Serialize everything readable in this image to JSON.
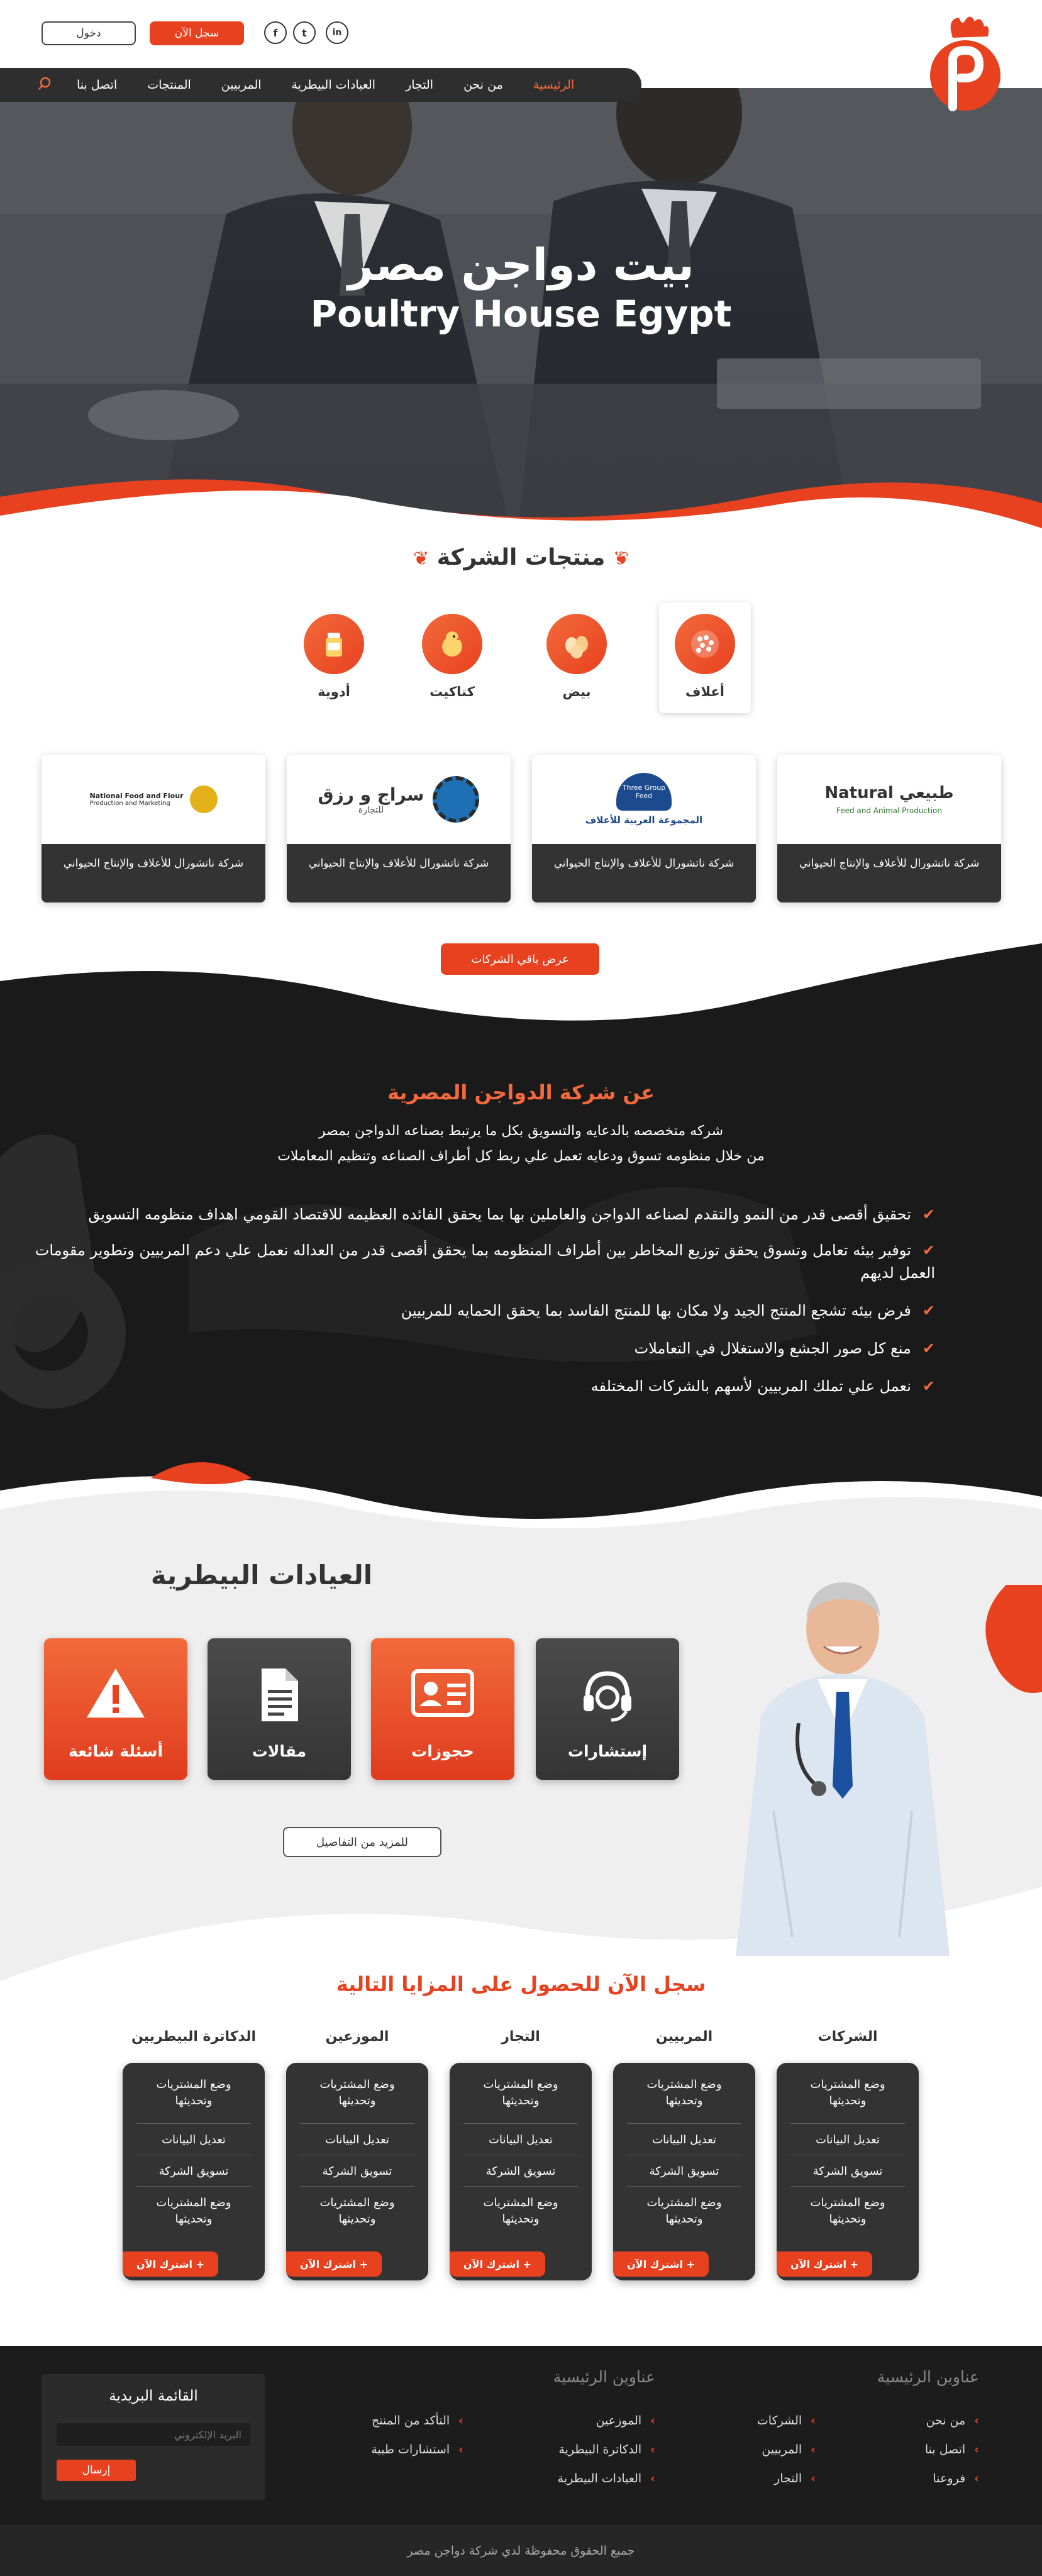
{
  "header": {
    "login_label": "دخول",
    "register_label": "سجل الآن",
    "social": [
      "f",
      "t",
      "in"
    ]
  },
  "nav": {
    "items": [
      "الرئيسية",
      "من نحن",
      "التجار",
      "العيادات البيطرية",
      "المربيين",
      "المنتجات",
      "اتصل بنا"
    ],
    "active": "الرئيسية"
  },
  "hero": {
    "title_ar": "بيت دواجن مصر",
    "title_en": "Poultry House Egypt"
  },
  "products": {
    "title": "منتجات الشركة",
    "categories": [
      "أعلاف",
      "بيض",
      "كتاكيت",
      "أدوية"
    ]
  },
  "companies": {
    "cards": [
      {
        "logo_text": "Natural طبيعي",
        "logo_sub": "Feed and Animal Production",
        "caption": "شركة ناتشورال للأعلاف والإنتاج الحيواني"
      },
      {
        "logo_text": "المجموعة العربية للأعلاف",
        "logo_sub": "Three Group Feed",
        "caption": "شركة ناتشورال للأعلاف والإنتاج الحيواني"
      },
      {
        "logo_text": "سراج و رزق",
        "logo_sub": "للتجارة",
        "caption": "شركة ناتشورال للأعلاف والإنتاج الحيواني"
      },
      {
        "logo_text": "National Food and Flour",
        "logo_sub": "Production and Marketing",
        "caption": "شركة ناتشورال للأعلاف والإنتاج الحيواني"
      }
    ],
    "more_label": "عرض باقي الشركات"
  },
  "about": {
    "title": "عن شركة الدواجن المصرية",
    "sub1": "شركه متخصصه بالدعايه والتسويق بكل ما يرتبط بصناعه الدواجن بمصر",
    "sub2": "من خلال منظومه تسوق ودعايه تعمل علي ربط كل أطراف الصناعه وتنظيم المعاملات",
    "points": [
      "تحقيق أقصى قدر من النمو والتقدم لصناعه الدواجن والعاملين بها بما يحقق الفائده العظيمه للاقتصاد القومي اهداف منظومه التسويق",
      "توفير بيئه تعامل وتسوق يحقق توزيع المخاطر بين أطراف المنظومه بما يحقق أقصى قدر من العداله  نعمل علي دعم المربيين وتطوير مقومات العمل لديهم",
      "فرض بيئه تشجع المنتج الجيد ولا مكان بها للمنتج الفاسد بما يحقق الحمايه للمربيين",
      "منع كل صور الجشع والاستغلال في التعاملات",
      "نعمل علي تملك المربيين لأسهم بالشركات المختلفه"
    ]
  },
  "clinics": {
    "title": "العيادات البيطرية",
    "cards": [
      "إستشارات",
      "حجوزات",
      "مقالات",
      "أسئلة شائعة"
    ],
    "details_label": "للمزيد من التفاصيل"
  },
  "plans": {
    "title": "سجل الآن للحصول على المزايا التالية",
    "columns": [
      {
        "name": "الشركات",
        "rows": [
          "وضع المشتريات وتحديثها",
          "تعديل البيانات",
          "تسويق الشركة",
          "وضع المشتريات وتحديثها"
        ]
      },
      {
        "name": "المربيين",
        "rows": [
          "وضع المشتريات وتحديثها",
          "تعديل البيانات",
          "تسويق الشركة",
          "وضع المشتريات وتحديثها"
        ]
      },
      {
        "name": "التجار",
        "rows": [
          "وضع المشتريات وتحديثها",
          "تعديل البيانات",
          "تسويق الشركة",
          "وضع المشتريات وتحديثها"
        ]
      },
      {
        "name": "الموزعين",
        "rows": [
          "وضع المشتريات وتحديثها",
          "تعديل البيانات",
          "تسويق الشركة",
          "وضع المشتريات وتحديثها"
        ]
      },
      {
        "name": "الدكاترة البيطريين",
        "rows": [
          "وضع المشتريات وتحديثها",
          "تعديل البيانات",
          "تسويق الشركة",
          "وضع المشتريات وتحديثها"
        ]
      }
    ],
    "subscribe_label": "اشترك الآن  +"
  },
  "footer": {
    "col1_title": "عناوين الرئيسية",
    "col1": [
      "من نحن",
      "اتصل بنا",
      "فروعنا"
    ],
    "col2": [
      "الشركات",
      "المربيين",
      "التجار"
    ],
    "col3_title": "عناوين الرئيسية",
    "col3": [
      "الموزعين",
      "الدكاترة البيطرية",
      "العيادات البيطرية"
    ],
    "col4": [
      "التأكد من المنتج",
      "استشارات طبية"
    ],
    "newsletter_title": "القائمة البريدية",
    "newsletter_placeholder": "البريد الإلكتروني",
    "newsletter_button": "إرسال",
    "copyright": "جميع الحقوق محفوظة لدي شركة دواجن مصر"
  },
  "colors": {
    "accent": "#e8411f",
    "accent_light": "#f26a3b",
    "dark": "#2e2e2e"
  }
}
